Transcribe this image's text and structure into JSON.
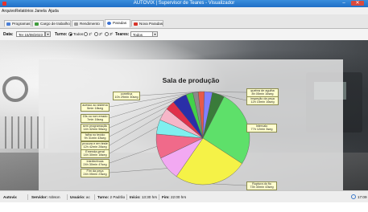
{
  "window": {
    "title": "AUTOVIX | Supervisor de Teares - Visualizador",
    "min_label": "–",
    "close_label": "✕"
  },
  "menu": [
    "Arquivo",
    "Relatórios",
    "Janela",
    "Ajuda"
  ],
  "tabs": [
    {
      "label": "Programas",
      "icon_color": "#4a7fd6"
    },
    {
      "label": "Cargo de trabalho",
      "icon_color": "#3f9b3c"
    },
    {
      "label": "Rendimento",
      "icon_color": "#9a9a9a"
    },
    {
      "label": "Paradas",
      "icon_color": "#3a6fd1"
    },
    {
      "label": "Nova Paradas",
      "icon_color": "#d8352a"
    }
  ],
  "filter": {
    "date_label": "Data:",
    "date_value": "Ter 15/08/2023",
    "shift_label": "Turno:",
    "shift_options": [
      {
        "label": "Todos",
        "selected": true
      },
      {
        "label": "1º",
        "selected": false
      },
      {
        "label": "2º",
        "selected": false
      },
      {
        "label": "3º",
        "selected": false
      }
    ],
    "looms_label": "Teares:",
    "looms_value": "Todos"
  },
  "chart_data": {
    "type": "pie",
    "title": "Sala de produção",
    "slices": [
      {
        "label": "quebra de agulha",
        "detail": "8h 05min 16seg",
        "value": 485,
        "color": "#8080ff"
      },
      {
        "label": "inspeção da peça",
        "detail": "12h 15min 16seg",
        "value": 735,
        "color": "#3a7b3a"
      },
      {
        "label": "Intervalo",
        "detail": "77h 12min 3seg",
        "value": 4632,
        "color": "#5ee06a"
      },
      {
        "label": "Ruptura do fio",
        "detail": "73h 30min 43seg",
        "value": 4410,
        "color": "#f5f247"
      },
      {
        "label": "Fim da peça",
        "detail": "24h 05min 23seg",
        "value": 1445,
        "color": "#f2a9f2"
      },
      {
        "label": "Interferência",
        "detail": "24h 30min 47seg",
        "value": 1470,
        "color": "#f06a8a"
      },
      {
        "label": "Emenda geral",
        "detail": "14h 30min 16seg",
        "value": 870,
        "color": "#7fefef"
      },
      {
        "label": "procura e em teste",
        "detail": "12h 42min 26seg",
        "value": 762,
        "color": "#f6b6c8"
      },
      {
        "label": "falha no tecido",
        "detail": "9h 31min 43seg",
        "value": 571,
        "color": "#e0304a"
      },
      {
        "label": "sem programação",
        "detail": "14h 32min 56seg",
        "value": 872,
        "color": "#2a2fa8"
      },
      {
        "label": "15s ou rom errado",
        "detail": "7min 16seg",
        "value": 420,
        "color": "#42d24a"
      },
      {
        "label": "acesso ao sistema",
        "detail": "5min 18seg",
        "value": 318,
        "color": "#8a8a8a"
      },
      {
        "label": "corretiva",
        "detail": "10h 29min 30seg",
        "value": 365,
        "color": "#e85a4a"
      }
    ]
  },
  "status": {
    "app": "Autovix",
    "server_label": "Servidor:",
    "server_value": "robson",
    "user_label": "Usuário:",
    "user_value": "ac",
    "shift_label": "Turno:",
    "shift_value": "2 Padrão",
    "start_label": "Início:",
    "start_value": "13:30 hrs",
    "end_label": "Fim:",
    "end_value": "22:00 hrs",
    "clock": "17:09"
  }
}
